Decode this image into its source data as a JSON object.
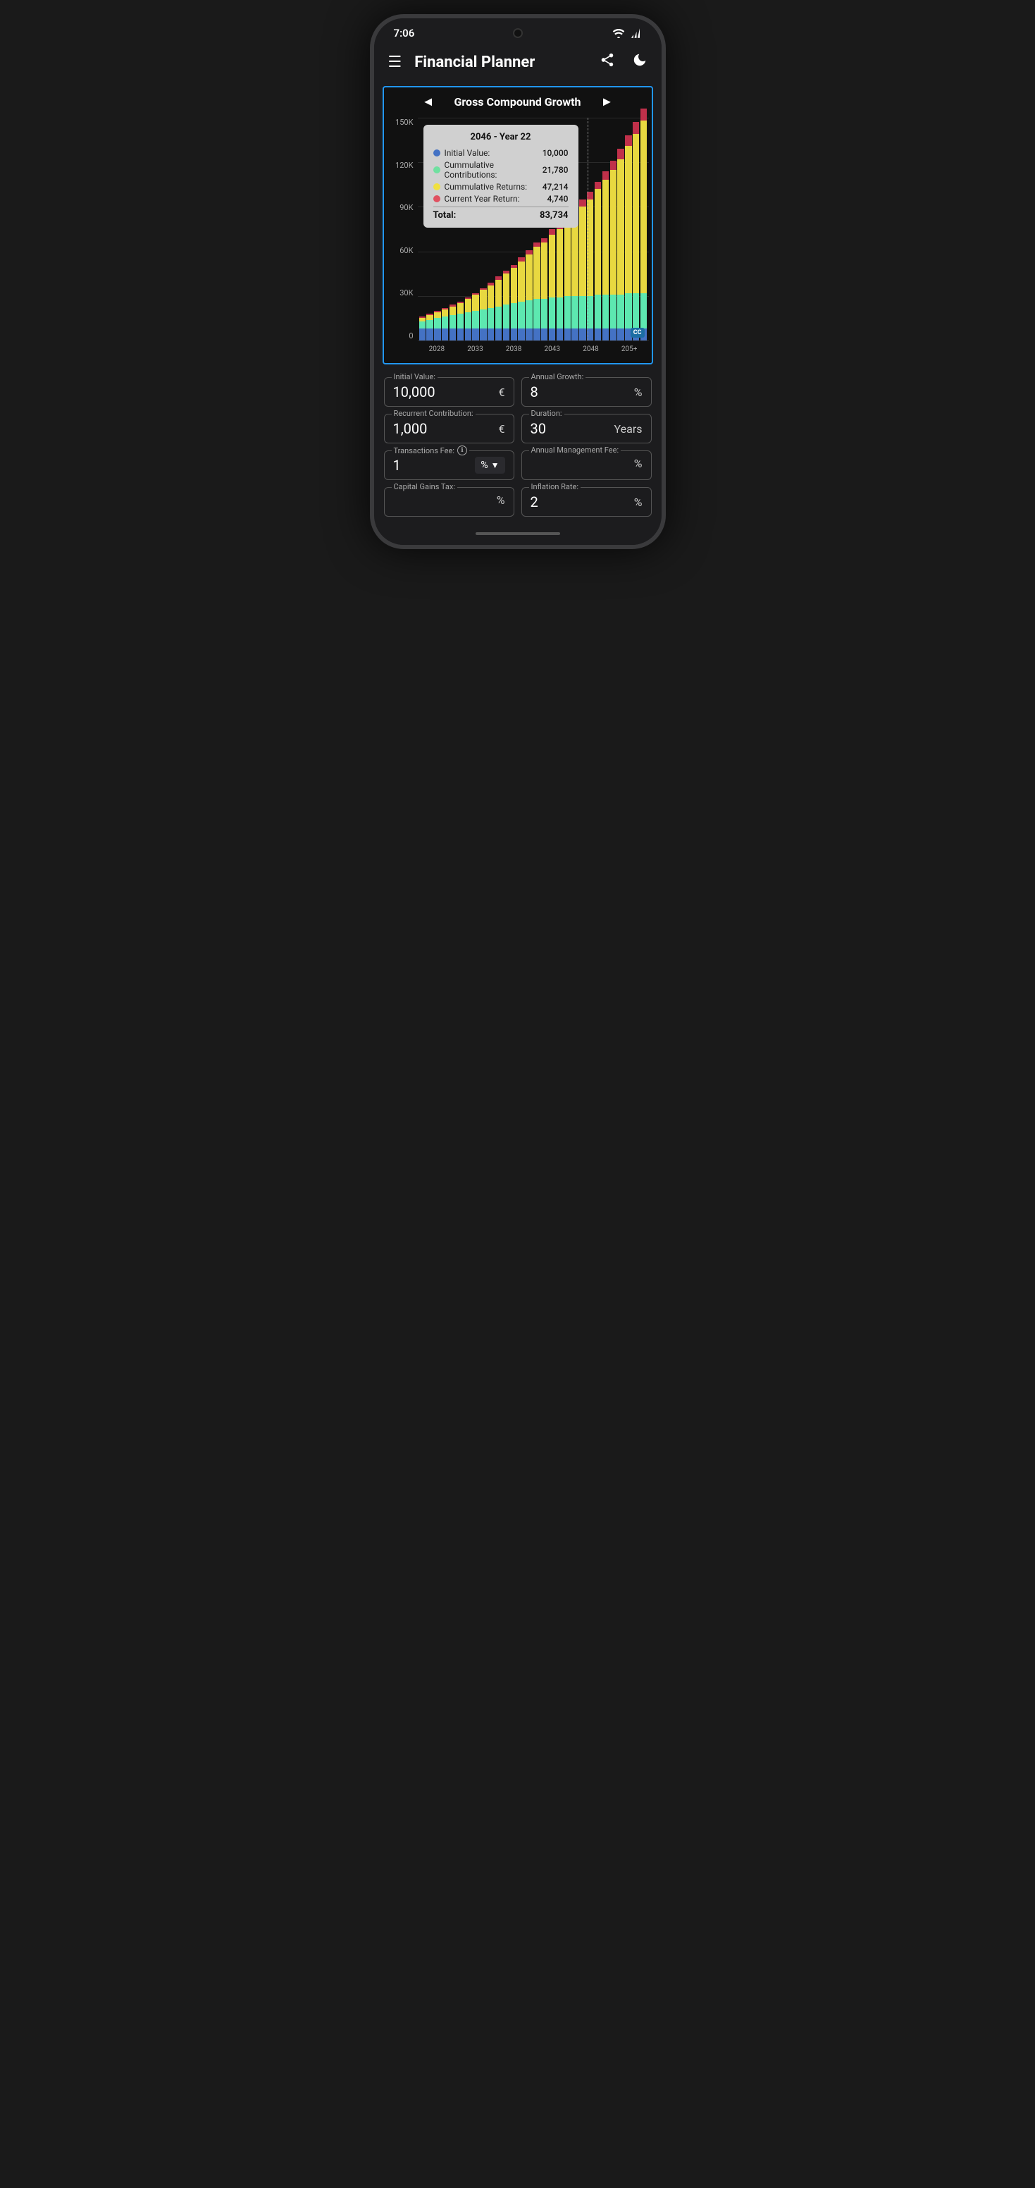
{
  "statusBar": {
    "time": "7:06"
  },
  "header": {
    "menuIcon": "☰",
    "title": "Financial Planner",
    "shareIcon": "share",
    "darkModeIcon": "moon"
  },
  "chart": {
    "title": "Gross Compound Growth",
    "prevLabel": "◄",
    "nextLabel": "►",
    "yLabels": [
      "150K",
      "120K",
      "90K",
      "60K",
      "30K",
      "0"
    ],
    "xLabels": [
      "2028",
      "2033",
      "2038",
      "2043",
      "2048",
      "205+"
    ],
    "ccBadge": "CC",
    "tooltip": {
      "title": "2046 - Year 22",
      "rows": [
        {
          "label": "Initial Value:",
          "value": "10,000",
          "color": "#4472C4"
        },
        {
          "label": "Cummulative Contributions:",
          "value": "21,780",
          "color": "#70e0a0"
        },
        {
          "label": "Cummulative Returns:",
          "value": "47,214",
          "color": "#f0e040"
        },
        {
          "label": "Current Year Return:",
          "value": "4,740",
          "color": "#e05060"
        }
      ],
      "totalLabel": "Total:",
      "totalValue": "83,734"
    },
    "bars": [
      {
        "initial": 8,
        "contrib": 5,
        "returns": 2,
        "curReturn": 1
      },
      {
        "initial": 8,
        "contrib": 6,
        "returns": 3,
        "curReturn": 1
      },
      {
        "initial": 8,
        "contrib": 7,
        "returns": 4,
        "curReturn": 1
      },
      {
        "initial": 8,
        "contrib": 8,
        "returns": 5,
        "curReturn": 1
      },
      {
        "initial": 8,
        "contrib": 9,
        "returns": 6,
        "curReturn": 1
      },
      {
        "initial": 8,
        "contrib": 10,
        "returns": 7,
        "curReturn": 1
      },
      {
        "initial": 8,
        "contrib": 11,
        "returns": 9,
        "curReturn": 1
      },
      {
        "initial": 8,
        "contrib": 12,
        "returns": 11,
        "curReturn": 1
      },
      {
        "initial": 8,
        "contrib": 13,
        "returns": 13,
        "curReturn": 1
      },
      {
        "initial": 8,
        "contrib": 14,
        "returns": 15,
        "curReturn": 2
      },
      {
        "initial": 8,
        "contrib": 15,
        "returns": 18,
        "curReturn": 2
      },
      {
        "initial": 8,
        "contrib": 16,
        "returns": 21,
        "curReturn": 2
      },
      {
        "initial": 8,
        "contrib": 17,
        "returns": 24,
        "curReturn": 2
      },
      {
        "initial": 8,
        "contrib": 18,
        "returns": 27,
        "curReturn": 3
      },
      {
        "initial": 8,
        "contrib": 19,
        "returns": 31,
        "curReturn": 3
      },
      {
        "initial": 8,
        "contrib": 20,
        "returns": 35,
        "curReturn": 3
      },
      {
        "initial": 8,
        "contrib": 20,
        "returns": 38,
        "curReturn": 3
      },
      {
        "initial": 8,
        "contrib": 21,
        "returns": 42,
        "curReturn": 4
      },
      {
        "initial": 8,
        "contrib": 21,
        "returns": 46,
        "curReturn": 4
      },
      {
        "initial": 8,
        "contrib": 22,
        "returns": 50,
        "curReturn": 4
      },
      {
        "initial": 8,
        "contrib": 22,
        "returns": 55,
        "curReturn": 4
      },
      {
        "initial": 8,
        "contrib": 22,
        "returns": 60,
        "curReturn": 5
      },
      {
        "initial": 8,
        "contrib": 22,
        "returns": 65,
        "curReturn": 5
      },
      {
        "initial": 8,
        "contrib": 23,
        "returns": 71,
        "curReturn": 5
      },
      {
        "initial": 8,
        "contrib": 23,
        "returns": 77,
        "curReturn": 6
      },
      {
        "initial": 8,
        "contrib": 23,
        "returns": 84,
        "curReturn": 6
      },
      {
        "initial": 8,
        "contrib": 23,
        "returns": 91,
        "curReturn": 7
      },
      {
        "initial": 8,
        "contrib": 24,
        "returns": 99,
        "curReturn": 7
      },
      {
        "initial": 8,
        "contrib": 24,
        "returns": 107,
        "curReturn": 8
      },
      {
        "initial": 8,
        "contrib": 24,
        "returns": 116,
        "curReturn": 8
      }
    ]
  },
  "form": {
    "fields": [
      {
        "id": "initial-value",
        "label": "Initial Value:",
        "value": "10,000",
        "unit": "€",
        "unitType": "symbol",
        "fullWidth": false
      },
      {
        "id": "annual-growth",
        "label": "Annual Growth:",
        "value": "8",
        "unit": "%",
        "unitType": "symbol",
        "fullWidth": false
      },
      {
        "id": "recurrent-contribution",
        "label": "Recurrent Contribution:",
        "value": "1,000",
        "unit": "€",
        "unitType": "symbol",
        "fullWidth": false
      },
      {
        "id": "duration",
        "label": "Duration:",
        "value": "30",
        "unit": "Years",
        "unitType": "text",
        "fullWidth": false
      },
      {
        "id": "transactions-fee",
        "label": "Transactions Fee:",
        "value": "1",
        "unit": "%",
        "unitType": "dropdown",
        "hasInfo": true,
        "fullWidth": false
      },
      {
        "id": "annual-management-fee",
        "label": "Annual Management Fee:",
        "value": "",
        "unit": "%",
        "unitType": "symbol",
        "fullWidth": false
      },
      {
        "id": "capital-gains-tax",
        "label": "Capital Gains Tax:",
        "value": "",
        "unit": "%",
        "unitType": "symbol",
        "fullWidth": false
      },
      {
        "id": "inflation-rate",
        "label": "Inflation Rate:",
        "value": "2",
        "unit": "%",
        "unitType": "symbol",
        "fullWidth": false
      }
    ]
  }
}
